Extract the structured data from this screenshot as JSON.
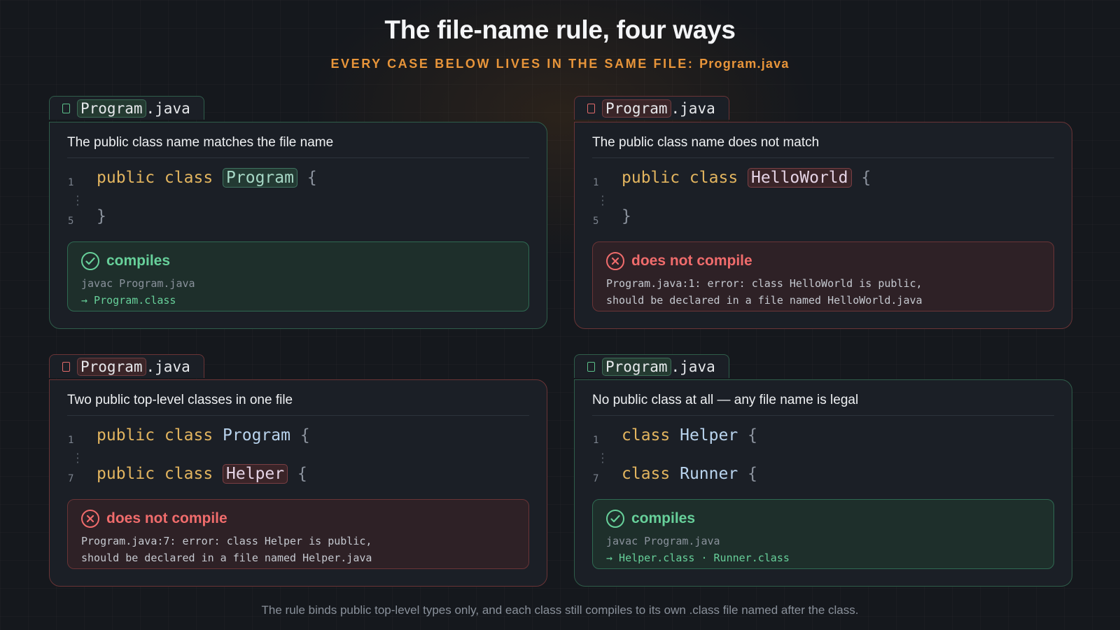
{
  "title": "The file-name rule, four ways",
  "subtitle_prefix": "EVERY CASE BELOW LIVES IN THE SAME FILE:",
  "subtitle_file": "Program.java",
  "cases": [
    {
      "tab_base": "Program",
      "tab_ext": ".java",
      "heading": "The public class name matches the file name",
      "lines": [
        {
          "num": "1",
          "keywords": "public class",
          "name": "Program",
          "brace": "{"
        },
        {
          "num": "5",
          "keywords": "",
          "name": "",
          "brace": "}"
        }
      ],
      "status": "compiles",
      "detail": [
        "javac Program.java",
        "→ Program.class"
      ]
    },
    {
      "tab_base": "Program",
      "tab_ext": ".java",
      "heading": "The public class name does not match",
      "lines": [
        {
          "num": "1",
          "keywords": "public class",
          "name": "HelloWorld",
          "brace": "{"
        },
        {
          "num": "5",
          "keywords": "",
          "name": "",
          "brace": "}"
        }
      ],
      "status": "does not compile",
      "detail": [
        "Program.java:1: error: class HelloWorld is public,",
        "should be declared in a file named HelloWorld.java"
      ]
    },
    {
      "tab_base": "Program",
      "tab_ext": ".java",
      "heading": "Two public top-level classes in one file",
      "lines": [
        {
          "num": "1",
          "keywords": "public class",
          "name": "Program",
          "brace": "{"
        },
        {
          "num": "7",
          "keywords": "public class",
          "name": "Helper",
          "brace": "{"
        }
      ],
      "status": "does not compile",
      "detail": [
        "Program.java:7: error: class Helper is public,",
        "should be declared in a file named Helper.java"
      ]
    },
    {
      "tab_base": "Program",
      "tab_ext": ".java",
      "heading": "No public class at all — any file name is legal",
      "lines": [
        {
          "num": "1",
          "keywords": "class",
          "name": "Helper",
          "brace": "{"
        },
        {
          "num": "7",
          "keywords": "class",
          "name": "Runner",
          "brace": "{"
        }
      ],
      "status": "compiles",
      "detail": [
        "javac Program.java",
        "→ Helper.class · Runner.class"
      ]
    }
  ],
  "footer": "The rule binds public top-level types only, and each class still compiles to its own .class file named after the class.",
  "colors": {
    "ok": "#67d09a",
    "bad": "#f06c6c",
    "keyword": "#e3b55f",
    "accent": "#e8953a"
  }
}
